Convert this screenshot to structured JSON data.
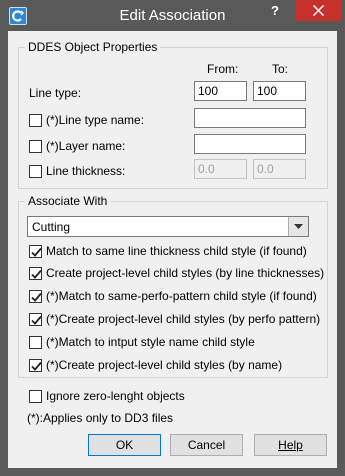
{
  "window": {
    "title": "Edit Association",
    "help_label": "?"
  },
  "ddes": {
    "group_label": "DDES Object Properties",
    "from_label": "From:",
    "to_label": "To:",
    "line_type_label": "Line type:",
    "line_type_from": "100",
    "line_type_to": "100",
    "line_type_name_label": "(*)Line type name:",
    "line_type_name_value": "",
    "layer_name_label": "(*)Layer name:",
    "layer_name_value": "",
    "line_thickness_label": "Line thickness:",
    "line_thickness_from": "0.0",
    "line_thickness_to": "0.0"
  },
  "associate": {
    "group_label": "Associate With",
    "dropdown_value": "Cutting",
    "options": [
      {
        "label": "Match to same line thickness child style (if found)",
        "checked": true
      },
      {
        "label": "Create project-level child styles (by line thicknesses)",
        "checked": true
      },
      {
        "label": "(*)Match to same-perfo-pattern child style (if found)",
        "checked": true
      },
      {
        "label": "(*)Create project-level child styles (by perfo pattern)",
        "checked": true
      },
      {
        "label": "(*)Match to intput style name child style",
        "checked": false
      },
      {
        "label": "(*)Create project-level child styles (by name)",
        "checked": true
      }
    ]
  },
  "ignore_zero_label": "Ignore zero-lenght objects",
  "ignore_zero_checked": false,
  "footnote": "(*):Applies only to DD3 files",
  "buttons": {
    "ok": "OK",
    "cancel": "Cancel",
    "help": "Help"
  },
  "colors": {
    "titlebar": "#595959",
    "close": "#c7312b",
    "dialog_bg": "#f0f0f0"
  }
}
